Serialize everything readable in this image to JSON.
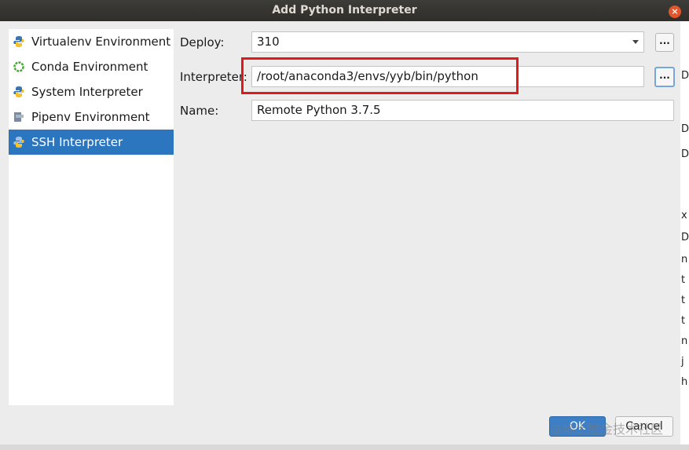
{
  "window": {
    "title": "Add Python Interpreter",
    "close_glyph": "×"
  },
  "sidebar": {
    "items": [
      {
        "label": "Virtualenv Environment",
        "icon": "python-icon",
        "selected": false
      },
      {
        "label": "Conda Environment",
        "icon": "conda-ring-icon",
        "selected": false
      },
      {
        "label": "System Interpreter",
        "icon": "python-icon",
        "selected": false
      },
      {
        "label": "Pipenv Environment",
        "icon": "pipenv-icon",
        "selected": false
      },
      {
        "label": "SSH Interpreter",
        "icon": "ssh-python-icon",
        "selected": true
      }
    ]
  },
  "form": {
    "deploy_label": "Deploy:",
    "deploy_value": "310",
    "interpreter_label": "Interpreter:",
    "interpreter_value": "/root/anaconda3/envs/yyb/bin/python",
    "name_label": "Name:",
    "name_value": "Remote Python 3.7.5",
    "browse_label": "..."
  },
  "buttons": {
    "ok": "OK",
    "cancel": "Cancel"
  },
  "watermark": "@稀土掘金技术社区",
  "background_window_chars": [
    "D",
    "D",
    "D",
    "",
    "x",
    "D",
    "n",
    "t",
    "t",
    "t",
    "n",
    "j",
    "h"
  ],
  "colors": {
    "selection": "#2c76c0",
    "highlight": "#e01a1a",
    "title_bar": "#33322f"
  }
}
